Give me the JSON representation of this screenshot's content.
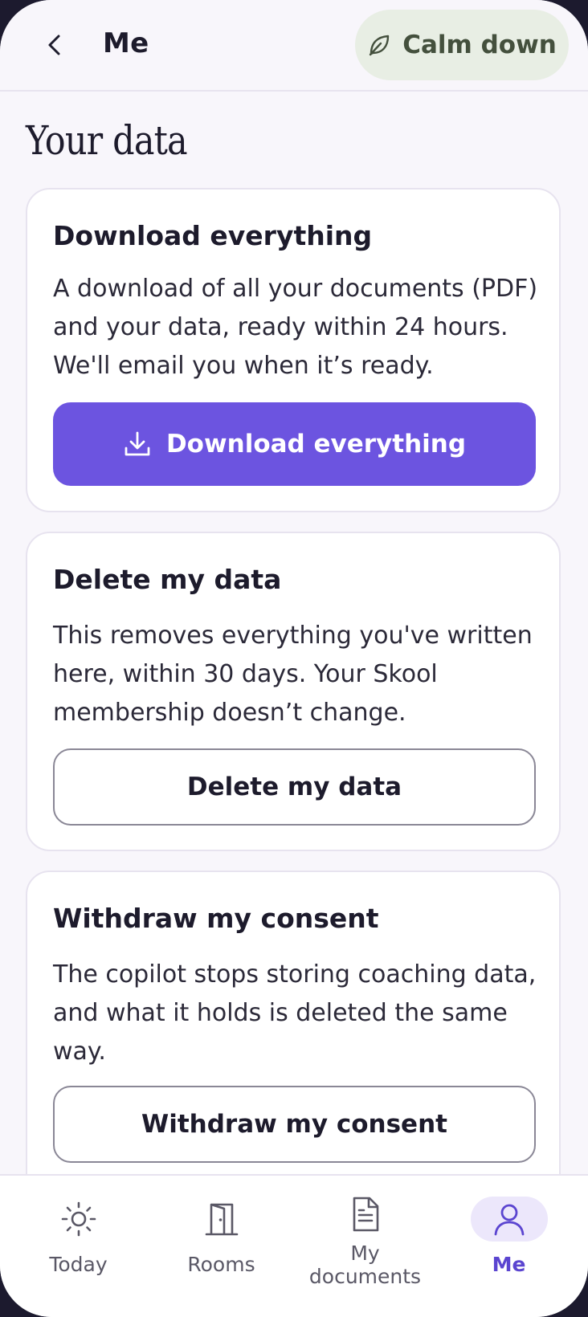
{
  "header": {
    "title": "Me",
    "calm_label": "Calm down"
  },
  "page_title": "Your data",
  "cards": {
    "download": {
      "title": "Download everything",
      "body": "A download of all your documents (PDF) and your data, ready within 24 hours. We'll email you when it’s ready.",
      "button": "Download everything"
    },
    "delete": {
      "title": "Delete my data",
      "body": "This removes everything you've written here, within 30 days. Your Skool membership doesn’t change.",
      "button": "Delete my data"
    },
    "withdraw": {
      "title": "Withdraw my consent",
      "body": "The copilot stops storing coaching data, and what it holds is deleted the same way.",
      "button": "Withdraw my consent"
    }
  },
  "nav": {
    "today": "Today",
    "rooms": "Rooms",
    "documents_line1": "My",
    "documents_line2": "documents",
    "me": "Me"
  },
  "colors": {
    "accent": "#6c54e0",
    "calm_bg": "#e8eee4",
    "active_nav": "#5b45d0"
  },
  "icons": {
    "back": "chevron-left-icon",
    "calm": "leaf-icon",
    "download": "download-icon",
    "today": "sun-icon",
    "rooms": "door-icon",
    "documents": "document-icon",
    "me": "user-icon"
  }
}
